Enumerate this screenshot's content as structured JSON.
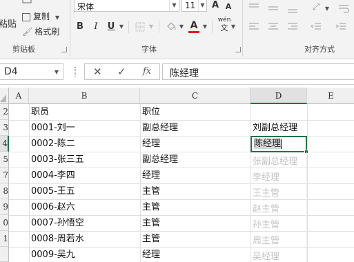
{
  "ribbon": {
    "clipboard": {
      "paste": "粘贴",
      "copy": "复制",
      "format_painter": "格式刷",
      "group_label": "剪贴板"
    },
    "font": {
      "font_name": "宋体",
      "font_size": "11",
      "grow": "A",
      "shrink": "A",
      "bold": "B",
      "italic": "I",
      "underline": "U",
      "phonetic": "wén",
      "phonetic_sub": "文",
      "group_label": "字体",
      "font_color": "#e0201b"
    },
    "alignment": {
      "group_label": "对齐方式"
    }
  },
  "formula_bar": {
    "name_box": "D4",
    "cancel": "✕",
    "enter": "✓",
    "fx": "fx",
    "content": "陈经理"
  },
  "sheet": {
    "columns": [
      "A",
      "B",
      "C",
      "D",
      "E"
    ],
    "rows": [
      "2",
      "3",
      "4",
      "5",
      "7",
      "8",
      "9",
      "0",
      "1"
    ],
    "cells": {
      "b_header": "职员",
      "c_header": "职位",
      "b": [
        "0001-刘一",
        "0002-陈二",
        "0003-张三五",
        "0004-李四",
        "0005-王五",
        "0006-赵六",
        "0007-孙悟空",
        "0008-周若水",
        "0009-吴九"
      ],
      "c": [
        "副总经理",
        "经理",
        "副总经理",
        "经理",
        "主管",
        "主管",
        "主管",
        "主管",
        "经理"
      ],
      "d3": "刘副总经理",
      "d4_typed": "陈经理"
    },
    "flash_fill_suggestions": [
      "张副总经理",
      "李经理",
      "王主管",
      "赵主管",
      "孙主管",
      "周主管",
      "吴经理"
    ],
    "accent_color": "#217346"
  }
}
